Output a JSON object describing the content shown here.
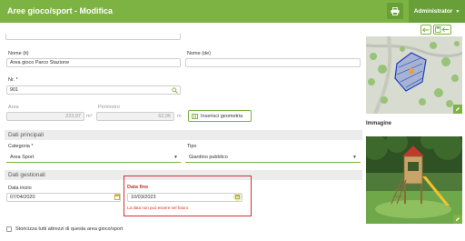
{
  "header": {
    "title": "Aree gioco/sport - Modifica",
    "user_label": "Administrator",
    "accent": "#7cb342"
  },
  "form": {
    "nome_it": {
      "label": "Nome (it)",
      "value": "Area gioco Parco Stazione"
    },
    "nome_de": {
      "label": "Nome (de)",
      "value": ""
    },
    "nr": {
      "label": "Nr. *",
      "value": "901"
    },
    "area": {
      "label": "Area",
      "value": "223,97",
      "unit": "m²"
    },
    "perimetro": {
      "label": "Perimetro",
      "value": "62,06",
      "unit": "m"
    },
    "geometry_button": "Inserisci geometria",
    "sections": {
      "principali": "Dati principali",
      "gestionali": "Dati gestionali"
    },
    "categoria": {
      "label": "Categoria *",
      "value": "Area Sport"
    },
    "tipo": {
      "label": "Tipo",
      "value": "Giardino pubblico"
    },
    "data_inizio": {
      "label": "Data inizio",
      "value": "07/04/2020"
    },
    "data_fine": {
      "label": "Data fine",
      "value": "10/03/2023",
      "error": "La data non può essere nel futuro"
    },
    "history_checkbox": "Storicizza tutti attrezzi di questa area gioco/sport"
  },
  "sidebar": {
    "image_title": "Immagine"
  },
  "colors": {
    "error": "#d32f2f",
    "section_bg": "#ececec"
  }
}
